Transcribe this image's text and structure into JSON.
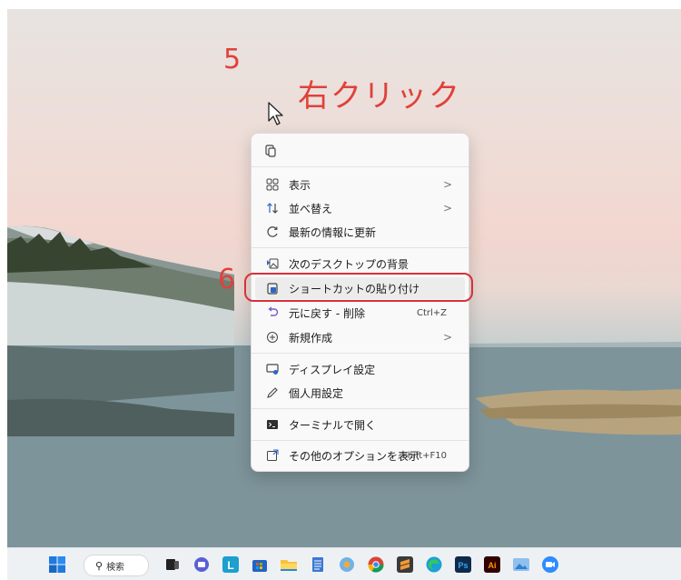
{
  "annotations": {
    "step5": "5",
    "right_click": "右クリック",
    "step6": "6"
  },
  "context_menu": {
    "items": [
      {
        "label": "表示",
        "icon": "grid-icon",
        "has_submenu": true
      },
      {
        "label": "並べ替え",
        "icon": "sort-icon",
        "has_submenu": true
      },
      {
        "label": "最新の情報に更新",
        "icon": "refresh-icon"
      },
      {
        "label": "次のデスクトップの背景",
        "icon": "next-background-icon"
      },
      {
        "label": "ショートカットの貼り付け",
        "icon": "paste-shortcut-icon",
        "highlighted": true
      },
      {
        "label": "元に戻す - 削除",
        "icon": "undo-icon",
        "shortcut": "Ctrl+Z"
      },
      {
        "label": "新規作成",
        "icon": "new-icon",
        "has_submenu": true
      },
      {
        "label": "ディスプレイ設定",
        "icon": "display-settings-icon"
      },
      {
        "label": "個人用設定",
        "icon": "personalize-icon"
      },
      {
        "label": "ターミナルで開く",
        "icon": "terminal-icon"
      },
      {
        "label": "その他のオプションを表示",
        "icon": "more-options-icon",
        "shortcut": "Shift+F10"
      }
    ],
    "submenu_glyph": ">"
  },
  "taskbar": {
    "search_label": "検索",
    "apps": [
      "start-icon",
      "task-view-icon",
      "chat-icon",
      "app-l-icon",
      "store-icon",
      "file-explorer-icon",
      "notepad-icon",
      "photos-icon",
      "chrome-icon",
      "sublime-icon",
      "edge-icon",
      "photoshop-icon",
      "illustrator-icon",
      "photo-viewer-icon",
      "zoom-icon"
    ]
  },
  "colors": {
    "annotation": "#e0413a",
    "menu_bg": "#f9f9f9"
  }
}
